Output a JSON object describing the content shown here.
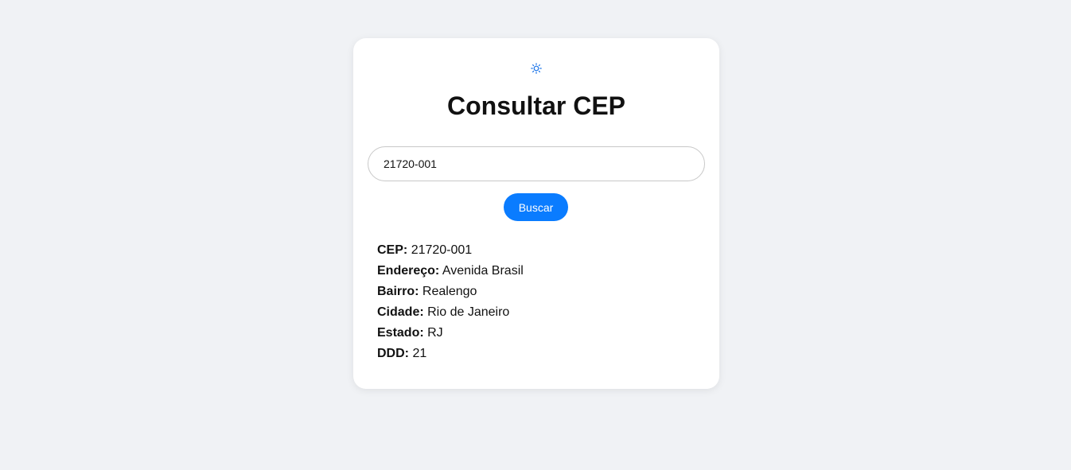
{
  "icons": {
    "theme_toggle": "sun-icon",
    "accent_color": "#0a7cff"
  },
  "card": {
    "title": "Consultar CEP"
  },
  "search": {
    "value": "21720-001",
    "button_label": "Buscar"
  },
  "results": [
    {
      "label": "CEP:",
      "value": "21720-001"
    },
    {
      "label": "Endereço:",
      "value": "Avenida Brasil"
    },
    {
      "label": "Bairro:",
      "value": "Realengo"
    },
    {
      "label": "Cidade:",
      "value": "Rio de Janeiro"
    },
    {
      "label": "Estado:",
      "value": "RJ"
    },
    {
      "label": "DDD:",
      "value": "21"
    }
  ]
}
